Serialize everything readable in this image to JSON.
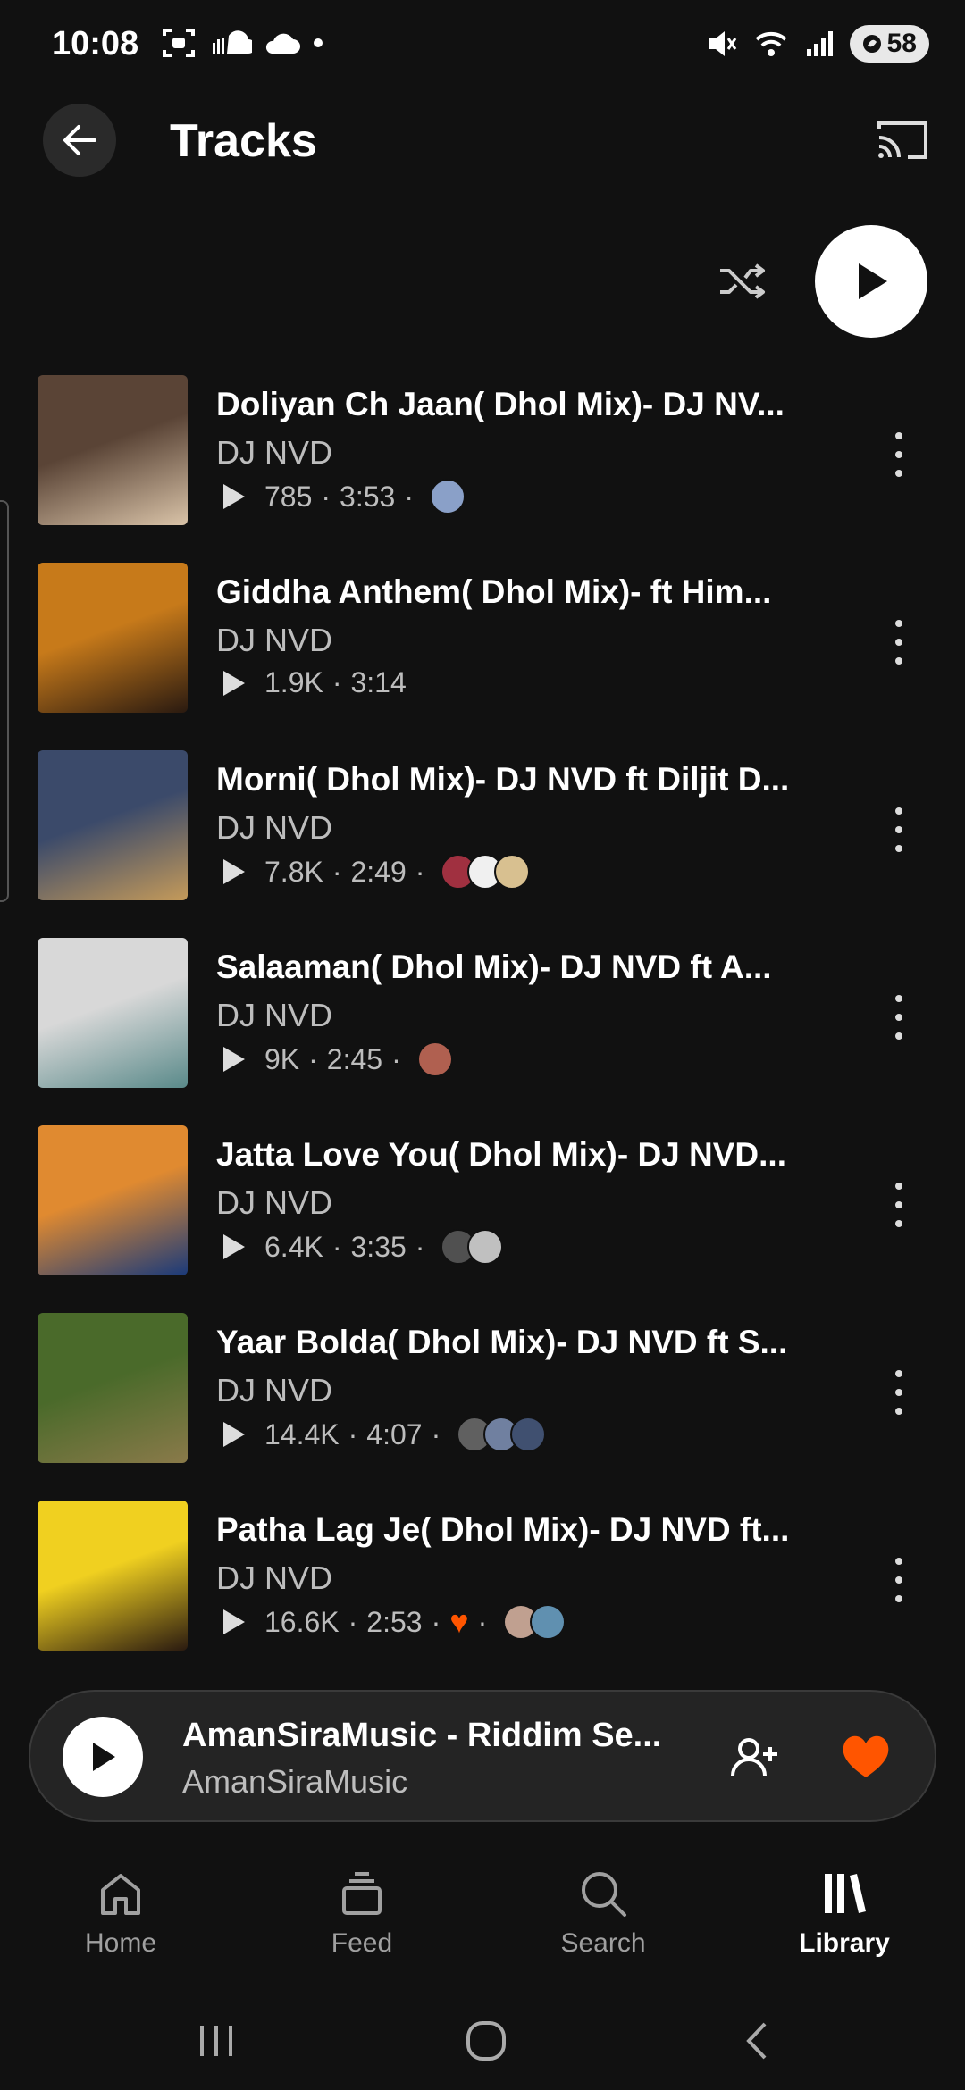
{
  "status_bar": {
    "time": "10:08",
    "battery": "58"
  },
  "header": {
    "title": "Tracks"
  },
  "tracks": [
    {
      "title": "Doliyan Ch Jaan( Dhol Mix)- DJ NV...",
      "artist": "DJ NVD",
      "plays": "785",
      "duration": "3:53",
      "liked": false,
      "art_colors": [
        "#5a4436",
        "#d9c3a8"
      ],
      "avatar_colors": [
        "#8aa0c8"
      ]
    },
    {
      "title": "Giddha Anthem( Dhol Mix)- ft Him...",
      "artist": "DJ NVD",
      "plays": "1.9K",
      "duration": "3:14",
      "liked": false,
      "art_colors": [
        "#c77a1a",
        "#2a1a10"
      ],
      "avatar_colors": []
    },
    {
      "title": "Morni( Dhol Mix)- DJ NVD ft Diljit D...",
      "artist": "DJ NVD",
      "plays": "7.8K",
      "duration": "2:49",
      "liked": false,
      "art_colors": [
        "#3b4a6a",
        "#c49a5a"
      ],
      "avatar_colors": [
        "#a03040",
        "#f0f0f0",
        "#d8c090"
      ]
    },
    {
      "title": "Salaaman( Dhol Mix)- DJ NVD ft A...",
      "artist": "DJ NVD",
      "plays": "9K",
      "duration": "2:45",
      "liked": false,
      "art_colors": [
        "#d8d8d8",
        "#5a8a8a"
      ],
      "avatar_colors": [
        "#b06050"
      ]
    },
    {
      "title": "Jatta Love You( Dhol Mix)- DJ NVD...",
      "artist": "DJ NVD",
      "plays": "6.4K",
      "duration": "3:35",
      "liked": false,
      "art_colors": [
        "#e08a30",
        "#1a3a7a"
      ],
      "avatar_colors": [
        "#505050",
        "#c0c0c0"
      ]
    },
    {
      "title": "Yaar Bolda( Dhol Mix)- DJ NVD ft S...",
      "artist": "DJ NVD",
      "plays": "14.4K",
      "duration": "4:07",
      "liked": false,
      "art_colors": [
        "#4a6a2a",
        "#8a7a4a"
      ],
      "avatar_colors": [
        "#606060",
        "#7080a0",
        "#405070"
      ]
    },
    {
      "title": "Patha Lag Je( Dhol Mix)- DJ NVD ft...",
      "artist": "DJ NVD",
      "plays": "16.6K",
      "duration": "2:53",
      "liked": true,
      "art_colors": [
        "#f0d020",
        "#2a1a10"
      ],
      "avatar_colors": [
        "#c0a090",
        "#6090b0"
      ]
    }
  ],
  "mini_player": {
    "title": "AmanSiraMusic  - Riddim Se...",
    "artist": "AmanSiraMusic"
  },
  "bottom_nav": {
    "items": [
      {
        "label": "Home",
        "icon": "home-icon"
      },
      {
        "label": "Feed",
        "icon": "feed-icon"
      },
      {
        "label": "Search",
        "icon": "search-icon"
      },
      {
        "label": "Library",
        "icon": "library-icon"
      }
    ],
    "active": "Library"
  },
  "colors": {
    "accent": "#ff5500",
    "background": "#111111"
  }
}
